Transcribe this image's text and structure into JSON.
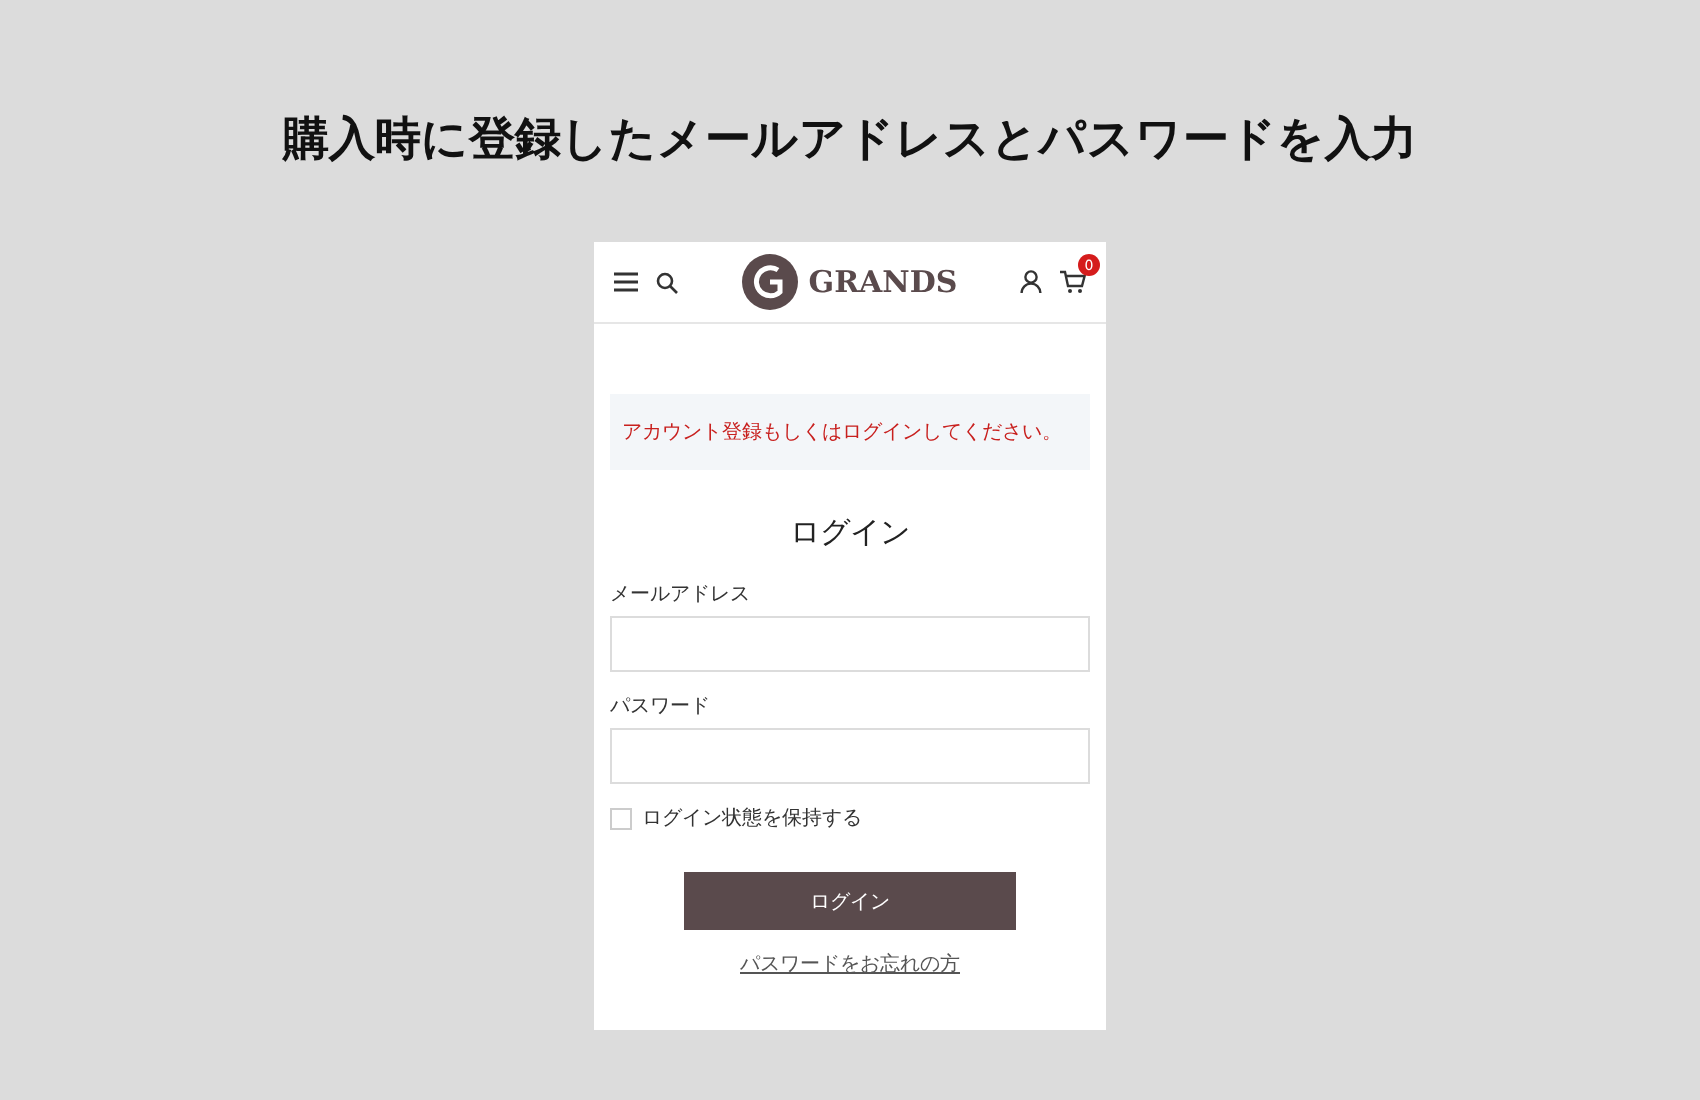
{
  "heading": "購入時に登録したメールアドレスとパスワードを入力",
  "header": {
    "logo_text": "GRANDS",
    "cart_count": "0"
  },
  "notice": "アカウント登録もしくはログインしてください。",
  "form": {
    "title": "ログイン",
    "fields": [
      {
        "label": "メールアドレス"
      },
      {
        "label": "パスワード"
      }
    ],
    "remember": {
      "label": "ログイン状態を保持する",
      "checked": false
    },
    "submit": "ログイン",
    "forgot_link": "パスワードをお忘れの方"
  }
}
